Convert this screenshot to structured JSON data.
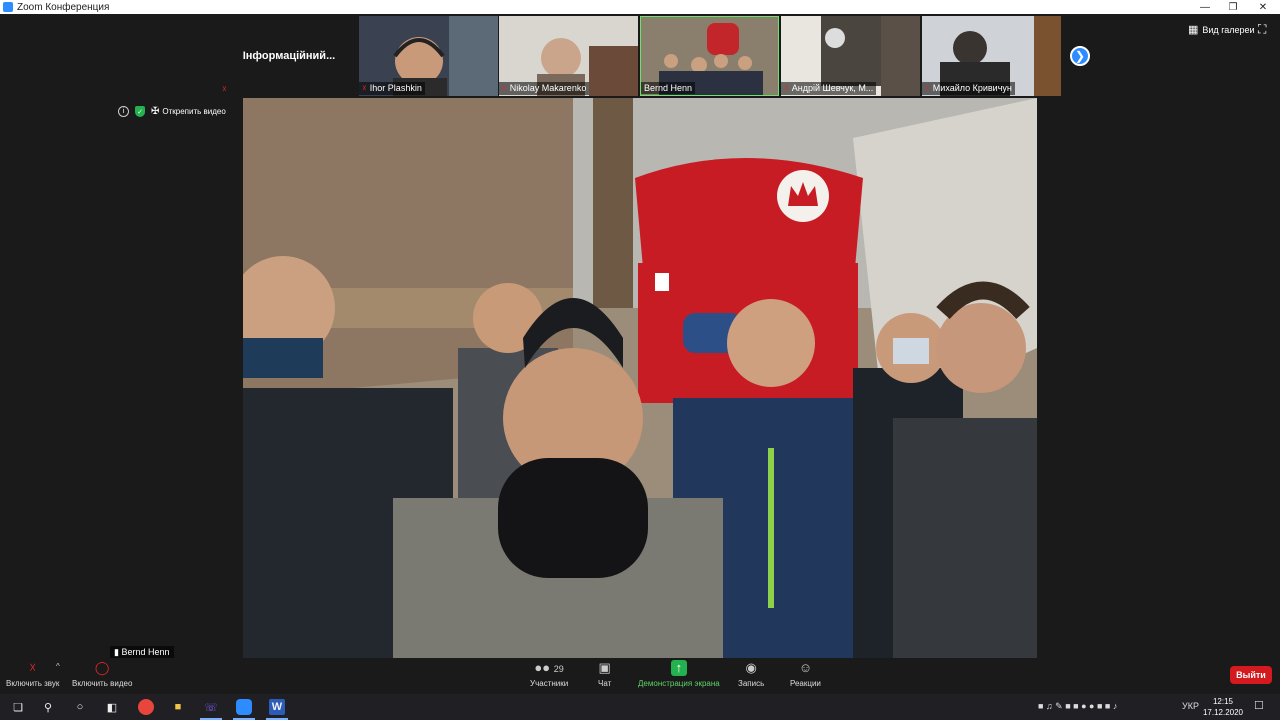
{
  "window": {
    "title": "Zoom Конференция"
  },
  "participant_strip": {
    "info_tile": "Інформаційний...",
    "tiles": [
      {
        "name": "Ihor Plashkin",
        "muted": true
      },
      {
        "name": "Nikolay Makarenko",
        "muted": true
      },
      {
        "name": "Bernd Henn",
        "muted": false
      },
      {
        "name": "Андрій Шевчук, М...",
        "muted": true
      },
      {
        "name": "Михайло Кривичун",
        "muted": true
      }
    ]
  },
  "view_controls": {
    "gallery_label": "Вид галереи"
  },
  "pinned": {
    "unpin_label": "Открепить видео"
  },
  "speaker": {
    "name": "Bernd Henn"
  },
  "toolbar": {
    "audio_label": "Включить звук",
    "video_label": "Включить видео",
    "participants_label": "Участники",
    "participants_count": "29",
    "chat_label": "Чат",
    "share_label": "Демонстрация экрана",
    "record_label": "Запись",
    "reactions_label": "Реакции",
    "leave_label": "Выйти"
  },
  "taskbar": {
    "language": "УКР",
    "time": "12:15",
    "date": "17.12.2020"
  },
  "colors": {
    "accent": "#2d8cff",
    "leave": "#d4191f",
    "share": "#23b24f"
  }
}
